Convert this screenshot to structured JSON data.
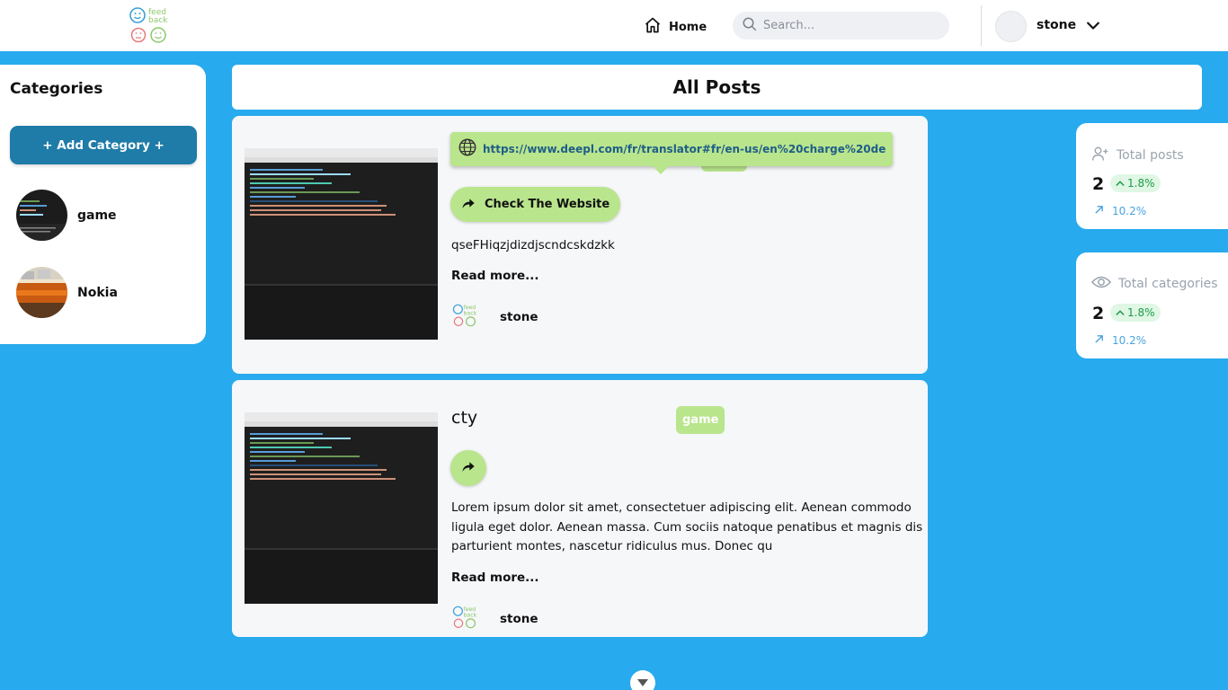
{
  "header": {
    "logo_icon": "feedback-logo",
    "home_label": "Home",
    "search_placeholder": "Search...",
    "username": "stone"
  },
  "sidebar": {
    "title": "Categories",
    "add_label": "+ Add Category +",
    "items": [
      {
        "label": "game"
      },
      {
        "label": "Nokia"
      }
    ]
  },
  "main": {
    "title": "All Posts"
  },
  "posts": [
    {
      "title": "",
      "link": "https://www.deepl.com/fr/translator#fr/en-us/en%20charge%20de",
      "category": "",
      "button_label": "Check The Website",
      "description": "qseFHiqzjdizdjscndcskdzkk",
      "read_more": "Read more...",
      "author": "stone"
    },
    {
      "title": "cty",
      "category": "game",
      "button_label": "",
      "description": "Lorem ipsum dolor sit amet, consectetuer adipiscing elit. Aenean commodo ligula eget dolor. Aenean massa. Cum sociis natoque penatibus et magnis dis parturient montes, nascetur ridiculus mus. Donec qu",
      "read_more": "Read more...",
      "author": "stone"
    }
  ],
  "stats": [
    {
      "label": "Total posts",
      "value": "2",
      "badge": "1.8%",
      "sub": "10.2%",
      "icon": "user-plus-icon"
    },
    {
      "label": "Total categories",
      "value": "2",
      "badge": "1.8%",
      "sub": "10.2%",
      "icon": "eye-icon"
    }
  ],
  "colors": {
    "background": "#27aaee",
    "accent_green": "#b9e58c",
    "button_blue": "#1f7ba8"
  }
}
